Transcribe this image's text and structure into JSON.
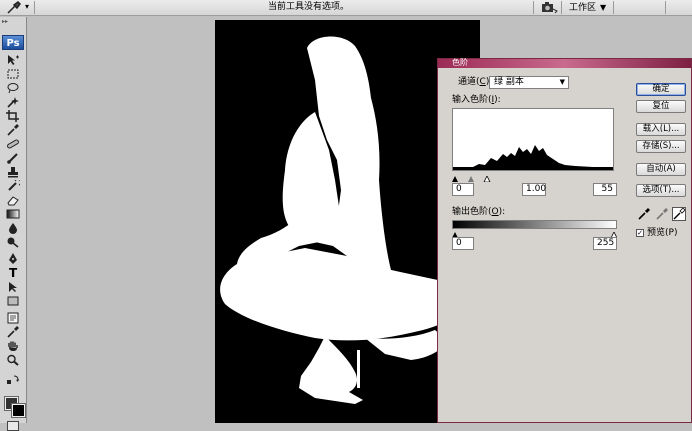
{
  "options_bar": {
    "hint_text": "当前工具没有选项。",
    "workspace_label": "工作区"
  },
  "toolbox": {
    "logo": "Ps",
    "tools": [
      "move",
      "marquee",
      "lasso",
      "quick-select",
      "crop",
      "eyedropper",
      "healing",
      "brush",
      "clone-stamp",
      "history-brush",
      "eraser",
      "gradient",
      "blur",
      "dodge",
      "pen",
      "type",
      "path-select",
      "shape",
      "notes",
      "zoom-eyedropper",
      "hand",
      "zoom"
    ],
    "text_tool_glyph": "T",
    "foreground_color": "#333333",
    "background_color": "#000000"
  },
  "levels_dialog": {
    "title": "色阶",
    "channel_label": "通道(",
    "channel_key": "C",
    "channel_label_end": "):",
    "channel_value": "绿 副本",
    "input_levels_label": "输入色阶(",
    "input_levels_key": "I",
    "input_levels_end": "):",
    "input_black": "0",
    "input_gamma": "1.00",
    "input_white": "55",
    "output_levels_label": "输出色阶(",
    "output_levels_key": "O",
    "output_levels_end": "):",
    "output_black": "0",
    "output_white": "255",
    "buttons": {
      "ok": "确定",
      "reset": "复位",
      "load": "载入(L)...",
      "save": "存储(S)...",
      "auto": "自动(A)",
      "options": "选项(T)..."
    },
    "preview_label": "预览(P)",
    "preview_checked": true
  },
  "colors": {
    "dialog_title_accent": "#9b2a55",
    "canvas_background": "#000000",
    "workspace_background": "#c0c0c0"
  }
}
